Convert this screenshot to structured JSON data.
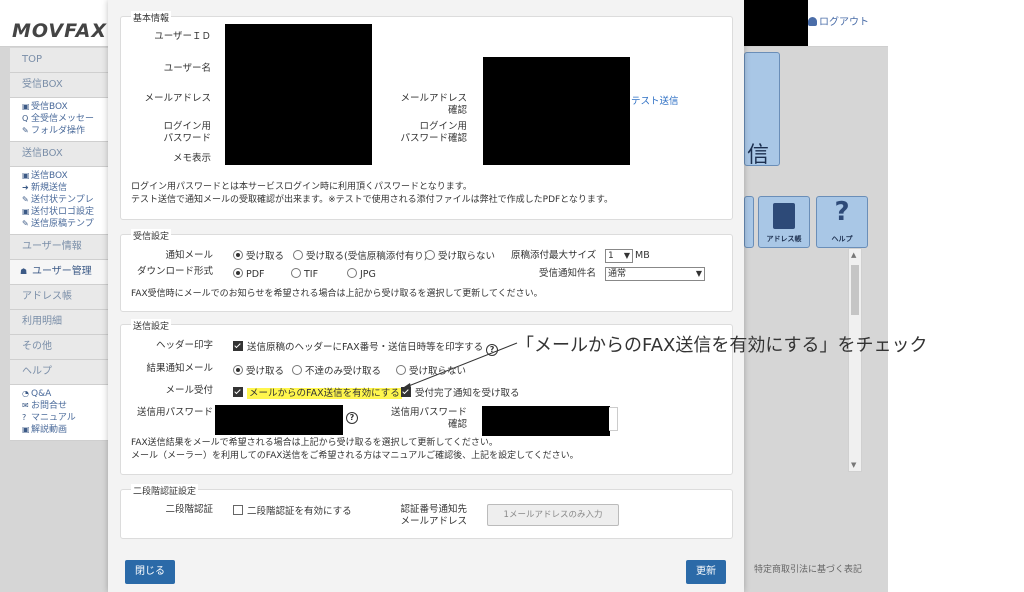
{
  "bg": {
    "logo": "MOVFAX",
    "logo_accent": "(",
    "logout": "ログアウト",
    "sidebar": [
      {
        "type": "section",
        "label": "TOP"
      },
      {
        "type": "section",
        "label": "受信BOX"
      },
      {
        "type": "sub",
        "items": [
          {
            "icon": "inbox-icon",
            "label": "受信BOX"
          },
          {
            "icon": "search-icon",
            "label": "全受信メッセー"
          },
          {
            "icon": "wrench-icon",
            "label": "フォルダ操作"
          }
        ]
      },
      {
        "type": "section",
        "label": "送信BOX"
      },
      {
        "type": "sub",
        "items": [
          {
            "icon": "outbox-icon",
            "label": "送信BOX"
          },
          {
            "icon": "new-icon",
            "label": "新規送信"
          },
          {
            "icon": "tag-icon",
            "label": "送付状テンプレ"
          },
          {
            "icon": "image-icon",
            "label": "送付状ロゴ設定"
          },
          {
            "icon": "edit-icon",
            "label": "送信原稿テンプ"
          }
        ]
      },
      {
        "type": "section",
        "label": "ユーザー情報"
      },
      {
        "type": "section",
        "label": "ユーザー管理",
        "active": true
      },
      {
        "type": "section",
        "label": "アドレス帳"
      },
      {
        "type": "section",
        "label": "利用明細"
      },
      {
        "type": "section",
        "label": "その他"
      },
      {
        "type": "section",
        "label": "ヘルプ"
      },
      {
        "type": "sub",
        "items": [
          {
            "icon": "chat-icon",
            "label": "Q&A"
          },
          {
            "icon": "mail-icon",
            "label": "お問合せ"
          },
          {
            "icon": "question-icon",
            "label": "マニュアル"
          },
          {
            "icon": "video-icon",
            "label": "解説動画"
          }
        ]
      }
    ],
    "tile_big_label": "信",
    "tile_labels": [
      "アドレス帳",
      "ヘルプ"
    ],
    "footer": "特定商取引法に基づく表記"
  },
  "basic": {
    "title": "基本情報",
    "user_id": "ユーザーＩＤ",
    "user_name": "ユーザー名",
    "mail": "メールアドレス",
    "mail_confirm_1": "メールアドレス",
    "mail_confirm_2": "確認",
    "test_send": "テスト送信",
    "login_pw_1": "ログイン用",
    "login_pw_2": "パスワード",
    "login_pw_c1": "ログイン用",
    "login_pw_c2": "パスワード確認",
    "memo": "メモ表示",
    "note1": "ログイン用パスワードとは本サービスログイン時に利用頂くパスワードとなります。",
    "note2": "テスト送信で通知メールの受取確認が出来ます。※テストで使用される添付ファイルは弊社で作成したPDFとなります。"
  },
  "receive": {
    "title": "受信設定",
    "notify_label": "通知メール",
    "notify_opts": [
      "受け取る",
      "受け取る(受信原稿添付有り)",
      "受け取らない"
    ],
    "max_size_label": "原稿添付最大サイズ",
    "max_size_value": "1",
    "max_size_unit": "MB",
    "download_label": "ダウンロード形式",
    "download_opts": [
      "PDF",
      "TIF",
      "JPG"
    ],
    "subject_label": "受信通知件名",
    "subject_value": "通常",
    "note": "FAX受信時にメールでのお知らせを希望される場合は上記から受け取るを選択して更新してください。"
  },
  "send": {
    "title": "送信設定",
    "header_label": "ヘッダー印字",
    "header_text": "送信原稿のヘッダーにFAX番号・送信日時等を印字する",
    "result_label": "結果通知メール",
    "result_opts": [
      "受け取る",
      "不達のみ受け取る",
      "受け取らない"
    ],
    "mail_recv_label": "メール受付",
    "mail_recv_text": "メールからのFAX送信を有効にする",
    "complete_text": "受付完了通知を受け取る",
    "send_pw_label": "送信用パスワード",
    "send_pw_c1": "送信用パスワード",
    "send_pw_c2": "確認",
    "note1": "FAX送信結果をメールで希望される場合は上記から受け取るを選択して更新してください。",
    "note2": "メール（メーラー）を利用してのFAX送信をご希望される方はマニュアルご確認後、上記を設定してください。"
  },
  "twofa": {
    "title": "二段階認証設定",
    "label": "二段階認証",
    "check_text": "二段階認証を有効にする",
    "dest_1": "認証番号通知先",
    "dest_2": "メールアドレス",
    "btn": "1メールアドレスのみ入力"
  },
  "footer": {
    "close": "閉じる",
    "update": "更新"
  },
  "annotation": "「メールからのFAX送信を有効にする」をチェック"
}
